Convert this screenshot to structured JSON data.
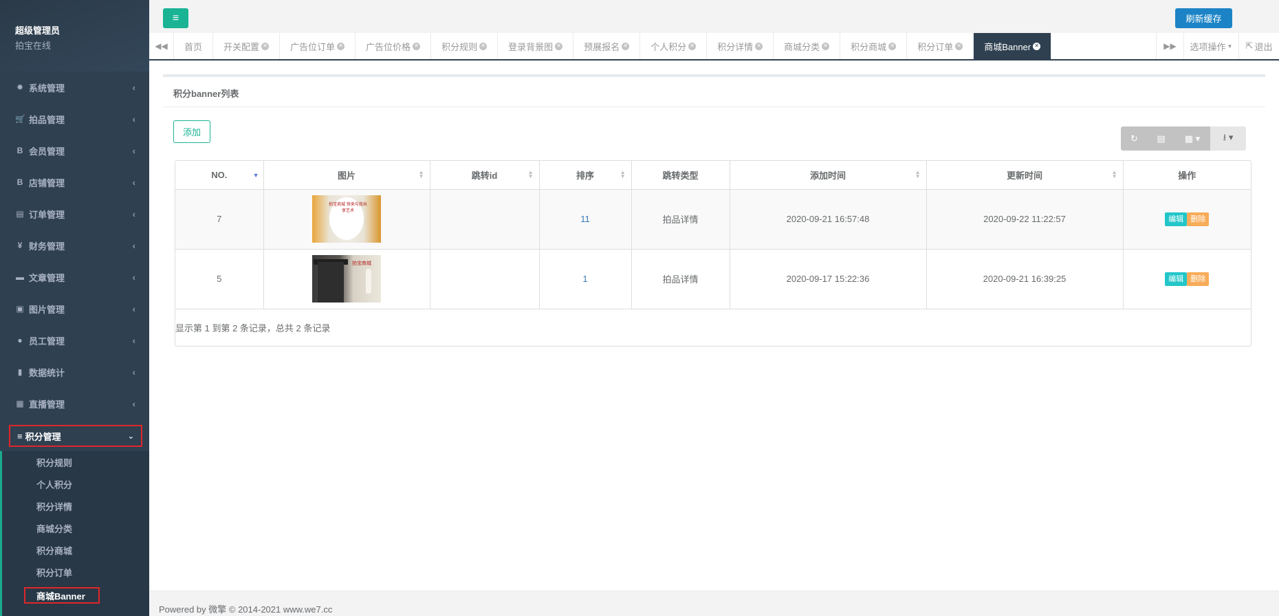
{
  "profile": {
    "name": "超级管理员",
    "status": "拍宝在线"
  },
  "sidebar": {
    "items": [
      {
        "icon": "✸",
        "label": "系统管理"
      },
      {
        "icon": "🛒",
        "label": "拍品管理"
      },
      {
        "icon": "B",
        "label": "会员管理"
      },
      {
        "icon": "B",
        "label": "店铺管理"
      },
      {
        "icon": "▤",
        "label": "订单管理"
      },
      {
        "icon": "¥",
        "label": "财务管理"
      },
      {
        "icon": "▬",
        "label": "文章管理"
      },
      {
        "icon": "▣",
        "label": "图片管理"
      },
      {
        "icon": "●",
        "label": "员工管理"
      },
      {
        "icon": "▮",
        "label": "数据统计"
      },
      {
        "icon": "▦",
        "label": "直播管理"
      }
    ],
    "active_item": {
      "icon": "≡",
      "label": "积分管理"
    },
    "sub_items": [
      "积分规则",
      "个人积分",
      "积分详情",
      "商城分类",
      "积分商城",
      "积分订单"
    ],
    "current_sub": "商城Banner"
  },
  "topbar": {
    "menu_icon": "≡",
    "refresh_label": "刷新缓存"
  },
  "tabs": {
    "items": [
      {
        "label": "首页",
        "closable": false
      },
      {
        "label": "开关配置",
        "closable": true
      },
      {
        "label": "广告位订单",
        "closable": true
      },
      {
        "label": "广告位价格",
        "closable": true
      },
      {
        "label": "积分规则",
        "closable": true
      },
      {
        "label": "登录背景图",
        "closable": true
      },
      {
        "label": "预展报名",
        "closable": true
      },
      {
        "label": "个人积分",
        "closable": true
      },
      {
        "label": "积分详情",
        "closable": true
      },
      {
        "label": "商城分类",
        "closable": true
      },
      {
        "label": "积分商城",
        "closable": true
      },
      {
        "label": "积分订单",
        "closable": true
      },
      {
        "label": "商城Banner",
        "closable": true,
        "active": true
      }
    ],
    "options_label": "选项操作",
    "logout_label": "退出"
  },
  "main": {
    "title": "积分banner列表",
    "add_label": "添加",
    "table": {
      "headers": [
        "NO.",
        "图片",
        "跳转id",
        "排序",
        "跳转类型",
        "添加时间",
        "更新时间",
        "操作"
      ],
      "rows": [
        {
          "no": "7",
          "jump_id": "",
          "sort": "11",
          "jump_type": "拍品详情",
          "created": "2020-09-21 16:57:48",
          "updated": "2020-09-22 11:22:57",
          "img_text": "拍宝商城 快来与我共享艺术",
          "edit": "编辑",
          "delete": "删除"
        },
        {
          "no": "5",
          "jump_id": "",
          "sort": "1",
          "jump_type": "拍品详情",
          "created": "2020-09-17 15:22:36",
          "updated": "2020-09-21 16:39:25",
          "img_text": "拍宝商城",
          "edit": "编辑",
          "delete": "删除"
        }
      ]
    },
    "pagination_info": "显示第 1 到第 2 条记录，总共 2 条记录"
  },
  "footer": {
    "text": "Powered by 微擎 © 2014-2021 www.we7.cc"
  }
}
